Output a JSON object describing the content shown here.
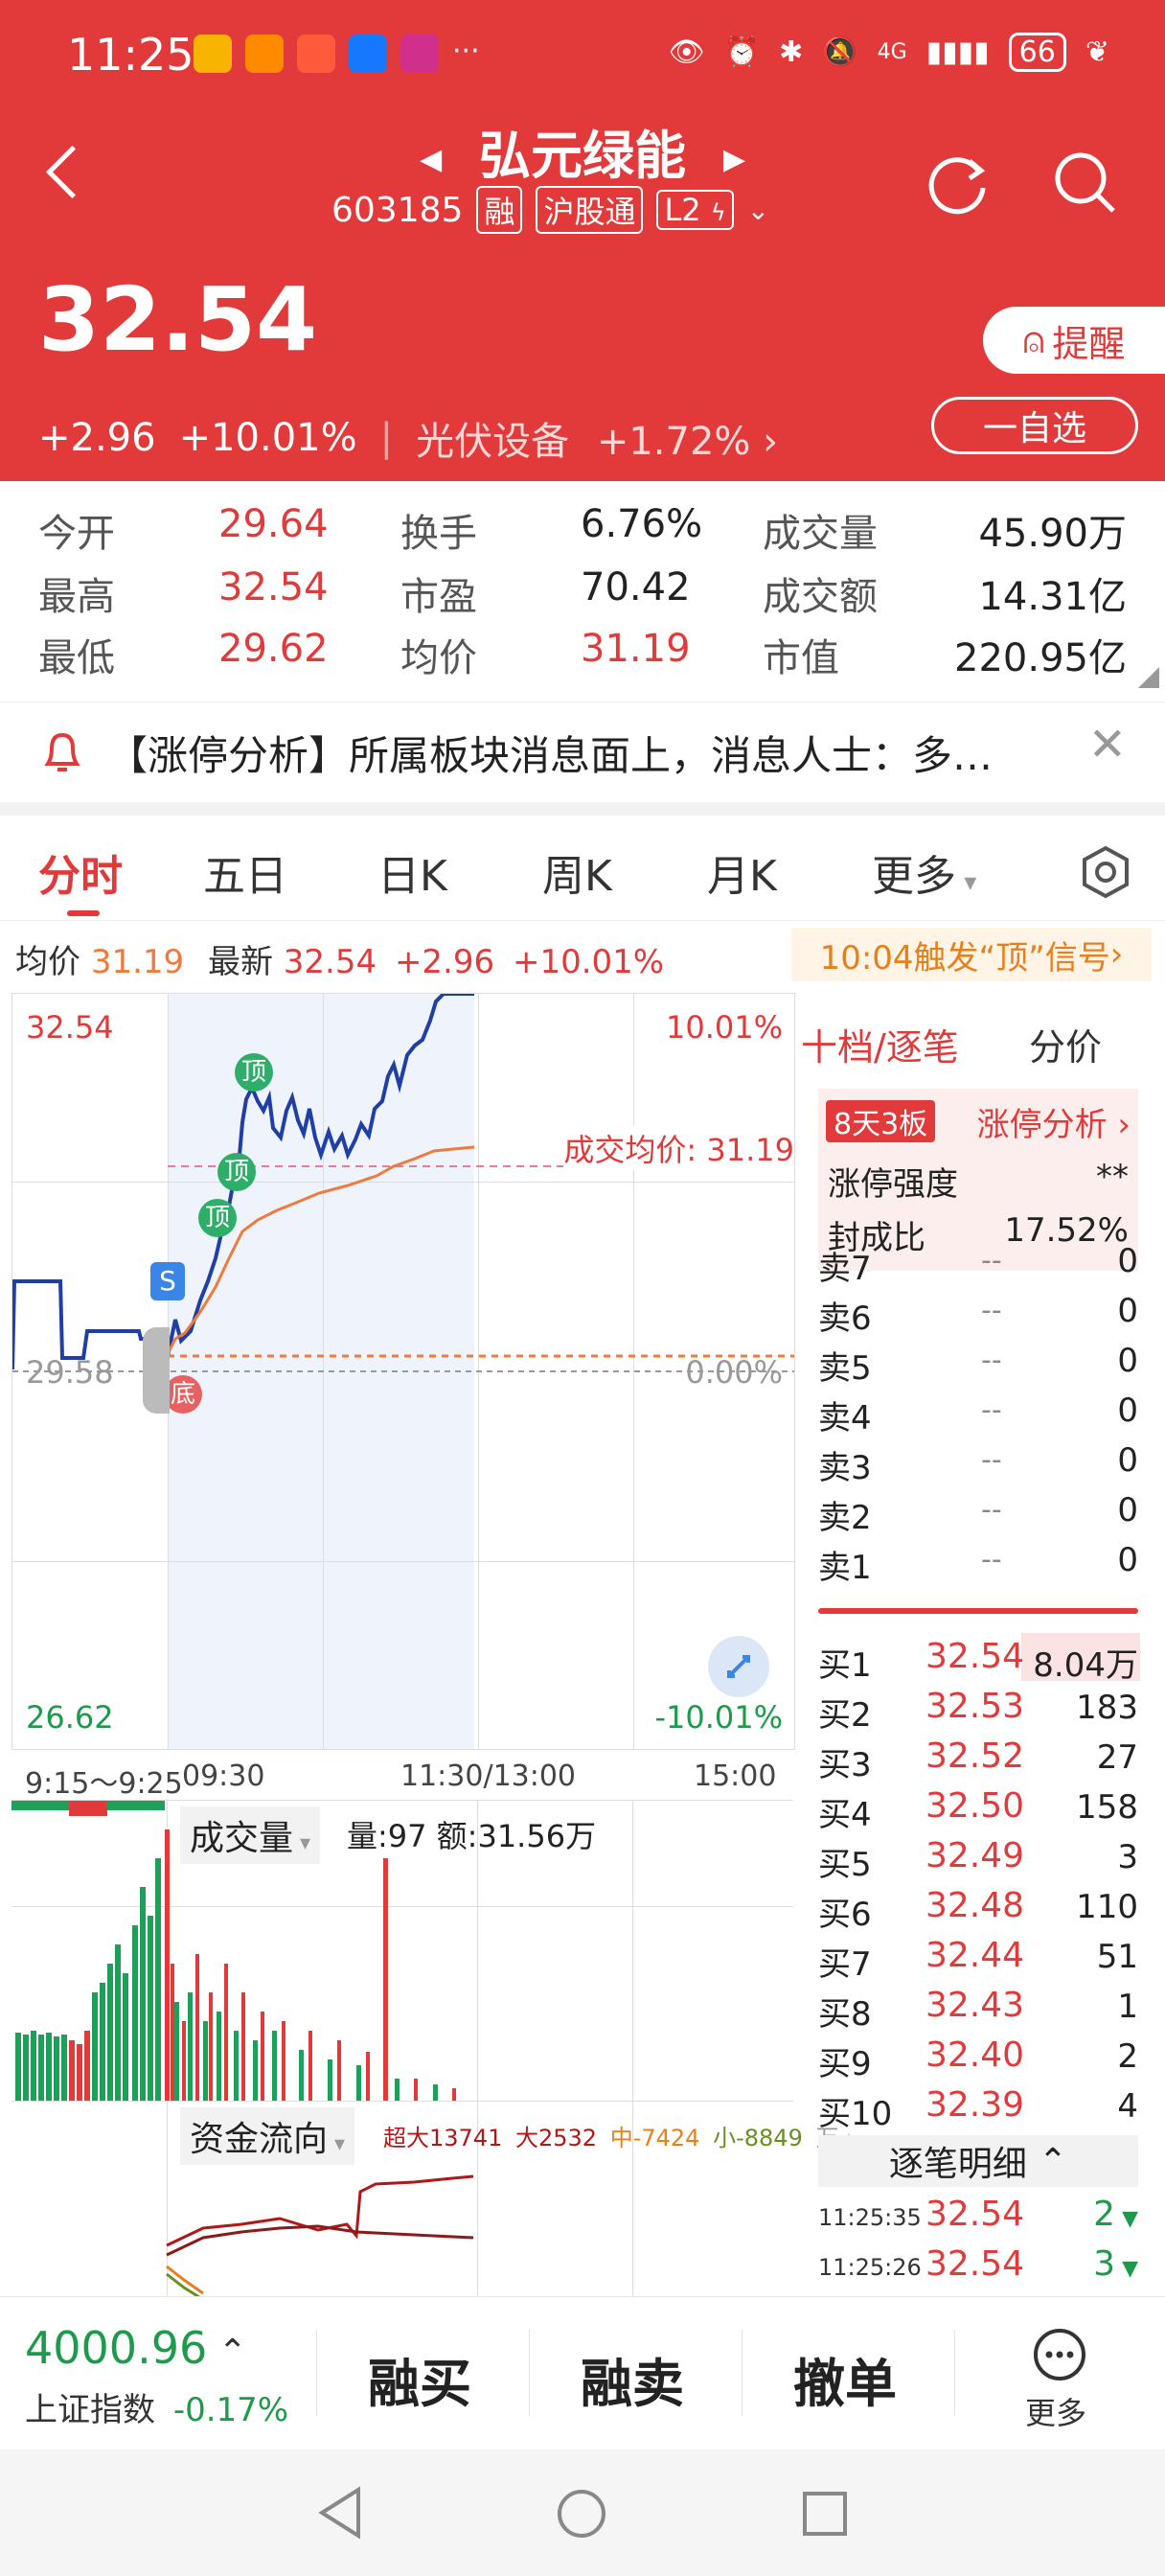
{
  "status_bar": {
    "time": "11:25",
    "network": "4G",
    "battery": "66"
  },
  "stock": {
    "name": "弘元绿能",
    "code": "603185",
    "tags": [
      "融",
      "沪股通",
      "L2"
    ],
    "price": "32.54",
    "change": "+2.96",
    "change_pct": "+10.01%",
    "sector": "光伏设备",
    "sector_pct": "+1.72%",
    "remind_label": "提醒",
    "fav_label": "一自选"
  },
  "stats": [
    {
      "label": "今开",
      "value": "29.64"
    },
    {
      "label": "换手",
      "value": "6.76%"
    },
    {
      "label": "成交量",
      "value": "45.90万"
    },
    {
      "label": "最高",
      "value": "32.54"
    },
    {
      "label": "市盈",
      "value": "70.42"
    },
    {
      "label": "成交额",
      "value": "14.31亿"
    },
    {
      "label": "最低",
      "value": "29.62"
    },
    {
      "label": "均价",
      "value": "31.19"
    },
    {
      "label": "市值",
      "value": "220.95亿"
    }
  ],
  "notice": {
    "text": "【涨停分析】所属板块消息面上，消息人士：多…"
  },
  "tabs": [
    "分时",
    "五日",
    "日K",
    "周K",
    "月K",
    "更多"
  ],
  "info_line": {
    "avg_label": "均价",
    "avg": "31.19",
    "latest_label": "最新",
    "latest": "32.54",
    "chg": "+2.96",
    "pct": "+10.01%",
    "signal": "10:04触发“顶”信号"
  },
  "chart": {
    "top_price": "32.54",
    "top_pct": "10.01%",
    "mid_price": "29.58",
    "mid_pct": "0.00%",
    "bottom_price": "26.62",
    "bottom_pct": "-10.01%",
    "avg_label": "成交均价: 31.19",
    "time_ticks": [
      "9:15～9:25",
      "09:30",
      "11:30/13:00",
      "15:00"
    ],
    "markers": {
      "top": "顶",
      "bottom": "底",
      "s": "S"
    }
  },
  "volume": {
    "label": "成交量",
    "info": "量:97 额:31.56万"
  },
  "fund": {
    "label": "资金流向",
    "super": "超大13741",
    "big": "大2532",
    "mid": "中-7424",
    "small": "小-8849",
    "unit": "万"
  },
  "panel": {
    "tab1": "十档/逐笔",
    "tab2": "分价",
    "limit_badge": "8天3板",
    "limit_link": "涨停分析",
    "strength_label": "涨停强度",
    "strength_value": "**",
    "seal_label": "封成比",
    "seal_value": "17.52%",
    "sells": [
      {
        "label": "卖7",
        "price": "--",
        "vol": "0"
      },
      {
        "label": "卖6",
        "price": "--",
        "vol": "0"
      },
      {
        "label": "卖5",
        "price": "--",
        "vol": "0"
      },
      {
        "label": "卖4",
        "price": "--",
        "vol": "0"
      },
      {
        "label": "卖3",
        "price": "--",
        "vol": "0"
      },
      {
        "label": "卖2",
        "price": "--",
        "vol": "0"
      },
      {
        "label": "卖1",
        "price": "--",
        "vol": "0"
      }
    ],
    "buys": [
      {
        "label": "买1",
        "price": "32.54",
        "vol": "8.04万"
      },
      {
        "label": "买2",
        "price": "32.53",
        "vol": "183"
      },
      {
        "label": "买3",
        "price": "32.52",
        "vol": "27"
      },
      {
        "label": "买4",
        "price": "32.50",
        "vol": "158"
      },
      {
        "label": "买5",
        "price": "32.49",
        "vol": "3"
      },
      {
        "label": "买6",
        "price": "32.48",
        "vol": "110"
      },
      {
        "label": "买7",
        "price": "32.44",
        "vol": "51"
      },
      {
        "label": "买8",
        "price": "32.43",
        "vol": "1"
      },
      {
        "label": "买9",
        "price": "32.40",
        "vol": "2"
      },
      {
        "label": "买10",
        "price": "32.39",
        "vol": "4"
      }
    ],
    "detail_label": "逐笔明细",
    "trades": [
      {
        "time": "11:25:35",
        "price": "32.54",
        "vol": "2"
      },
      {
        "time": "11:25:26",
        "price": "32.54",
        "vol": "3"
      }
    ]
  },
  "bottom": {
    "index_value": "4000.96",
    "index_name": "上证指数",
    "index_pct": "-0.17%",
    "buttons": [
      "融买",
      "融卖",
      "撤单"
    ],
    "more_label": "更多"
  },
  "colors": {
    "brand_red": "#e23a3a",
    "up_red": "#e23a3a",
    "down_green": "#1d9a4a",
    "price_line": "#1f3fa5",
    "avg_line": "#f07a3c"
  }
}
